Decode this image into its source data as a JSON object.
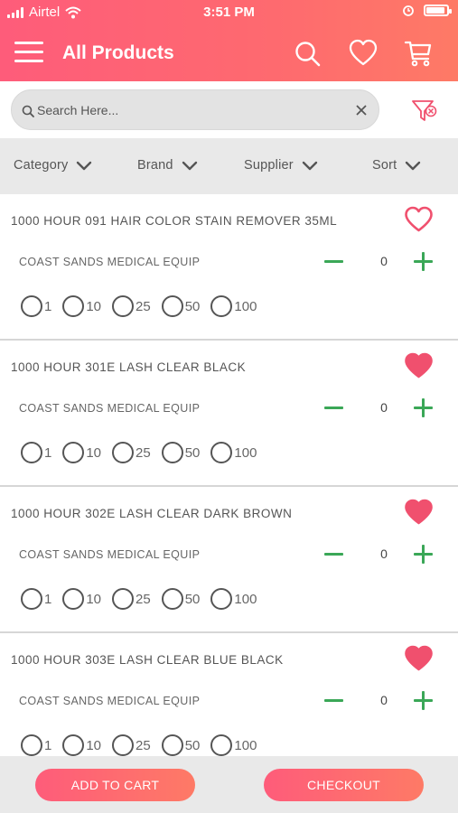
{
  "status_bar": {
    "carrier": "Airtel",
    "time": "3:51 PM",
    "battery_level": 0.9
  },
  "header": {
    "title": "All Products",
    "icons": [
      "menu-icon",
      "search-icon",
      "heart-icon",
      "cart-icon"
    ]
  },
  "search": {
    "placeholder": "Search Here...",
    "value": ""
  },
  "filters": [
    {
      "label": "Category"
    },
    {
      "label": "Brand"
    },
    {
      "label": "Supplier"
    },
    {
      "label": "Sort"
    }
  ],
  "products": [
    {
      "name": "1000 HOUR 091 HAIR COLOR STAIN REMOVER 35ML",
      "supplier": "COAST SANDS MEDICAL EQUIP",
      "qty": "0",
      "favorite": false
    },
    {
      "name": "1000 HOUR 301E LASH CLEAR BLACK",
      "supplier": "COAST SANDS MEDICAL EQUIP",
      "qty": "0",
      "favorite": true
    },
    {
      "name": "1000 HOUR 302E LASH CLEAR DARK BROWN",
      "supplier": "COAST SANDS MEDICAL EQUIP",
      "qty": "0",
      "favorite": true
    },
    {
      "name": "1000 HOUR 303E LASH CLEAR BLUE BLACK",
      "supplier": "COAST SANDS MEDICAL EQUIP",
      "qty": "0",
      "favorite": true
    }
  ],
  "qty_presets": [
    "1",
    "10",
    "25",
    "50",
    "100"
  ],
  "actions": {
    "add_to_cart": "ADD TO CART",
    "checkout": "CHECKOUT"
  },
  "colors": {
    "accent": "#fe6272",
    "accent_end": "#fe7a66",
    "favorite": "#f0506e",
    "qty_green": "#3aa757",
    "bar_gray": "#e9e9e9"
  }
}
